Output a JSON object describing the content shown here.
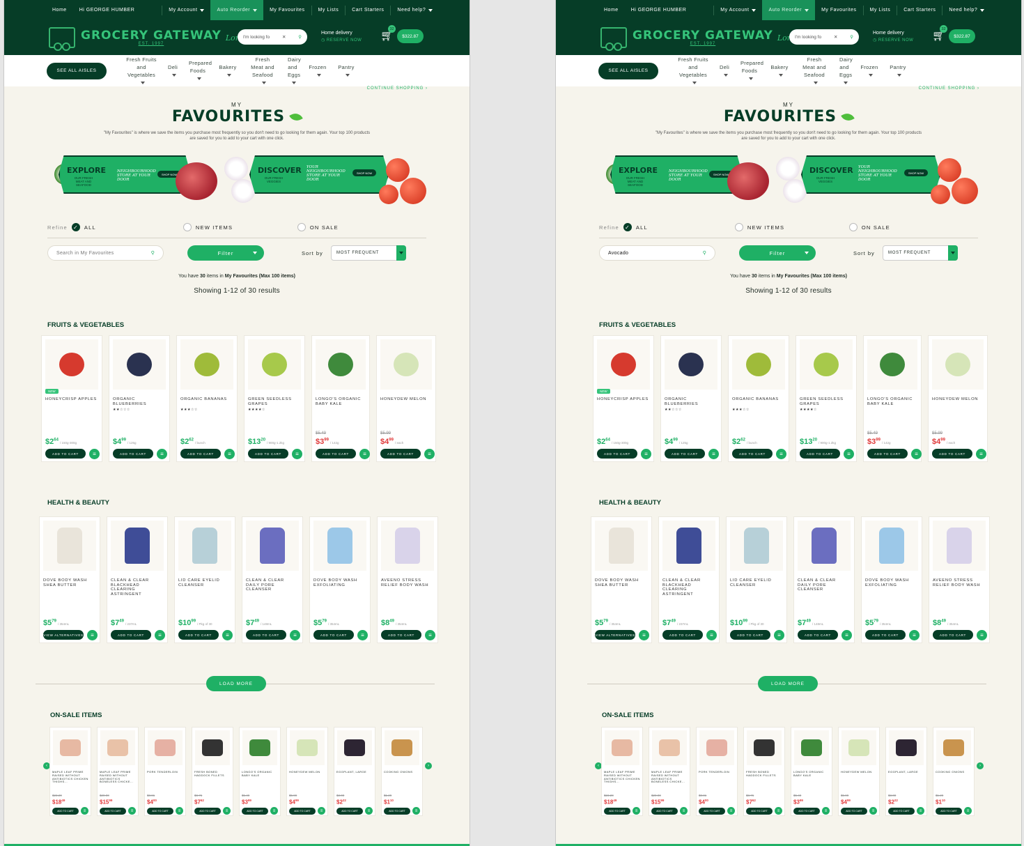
{
  "topbar": {
    "home": "Home",
    "greeting": "Hi  GEORGE HUMBER",
    "my_account": "My Account",
    "auto_reorder": "Auto Reorder",
    "my_favourites": "My Favourites",
    "my_lists": "My Lists",
    "cart_starters": "Cart Starters",
    "need_help": "Need help?"
  },
  "header": {
    "logo": "GROCERY GATEWAY",
    "logo_sub": "EST. 1997",
    "logo_script": "Longo's",
    "search_placeholder": "I'm looking fo",
    "delivery_title": "Home delivery",
    "delivery_sub": "RESERVE NOW",
    "cart_count": "32",
    "cart_total": "$322.87"
  },
  "nav": {
    "aisles_button": "SEE ALL AISLES",
    "items": [
      "Fresh Fruits and Vegetables",
      "Deli",
      "Prepared Foods",
      "Bakery",
      "Fresh Meat and Seafood",
      "Dairy and Eggs",
      "Frozen",
      "Pantry"
    ],
    "continue": "CONTINUE SHOPPING  ›"
  },
  "page": {
    "my": "MY",
    "title": "FAVOURITES",
    "desc": "\"My Favourites\" is where we save the items you purchase most frequently so you don't need to go looking for them again. Your top 100 products are saved for you to add to your cart with one click."
  },
  "banners": [
    {
      "big": "EXPLORE",
      "small": "OUR FRESH MEAT AND SEAFOOD",
      "script": "NEIGHBOURHOOD STORE AT YOUR DOOR",
      "shop": "SHOP NOW"
    },
    {
      "big": "DISCOVER",
      "small": "OUR FRESH VEGGIES",
      "script": "YOUR NEIGHBOURHOOD STORE AT YOUR DOOR",
      "shop": "SHOP NOW"
    }
  ],
  "refine": {
    "label": "Refine",
    "all": "ALL",
    "new_items": "NEW ITEMS",
    "on_sale": "ON SALE"
  },
  "controls": {
    "search_placeholder_left": "Search in My Favourites",
    "search_value_right": "Avocado",
    "filter": "Filter",
    "sort_label": "Sort by",
    "sort_value": "MOST FREQUENT"
  },
  "summary": {
    "prefix": "You have",
    "count": "30",
    "mid": "items in",
    "list": "My Favourites (Max 100 items)",
    "showing": "Showing 1-12 of 30 results"
  },
  "sections": {
    "fruits": "FRUITS & VEGETABLES",
    "health": "HEALTH & BEAUTY",
    "onsale": "ON-SALE ITEMS",
    "load_more": "LOAD MORE"
  },
  "fruits": [
    {
      "name": "HONEYCRISP APPLES",
      "stars": "",
      "was": "",
      "price": "$2",
      "cents": "64",
      "unit": "/ 150g-300g",
      "sale": false,
      "tag": "NEW",
      "btn": "ADD TO CART",
      "color": "#d63a2e"
    },
    {
      "name": "ORGANIC BLUEBERRIES",
      "stars": "★★☆☆☆",
      "was": "",
      "price": "$4",
      "cents": "99",
      "unit": "/ 125g",
      "sale": false,
      "tag": "",
      "btn": "ADD TO CART",
      "color": "#2a3250"
    },
    {
      "name": "ORGANIC BANANAS",
      "stars": "★★★☆☆",
      "was": "",
      "price": "$2",
      "cents": "62",
      "unit": "/ bunch",
      "sale": false,
      "tag": "",
      "btn": "ADD TO CART",
      "color": "#9fbb3a"
    },
    {
      "name": "GREEN SEEDLESS GRAPES",
      "stars": "★★★★☆",
      "was": "",
      "price": "$13",
      "cents": "20",
      "unit": "/ 900g-1.2kg",
      "sale": false,
      "tag": "",
      "btn": "ADD TO CART",
      "color": "#a7c94b"
    },
    {
      "name": "LONGO'S ORGANIC BABY KALE",
      "stars": "",
      "was": "$5.49",
      "price": "$3",
      "cents": "99",
      "unit": "/ 142g",
      "sale": true,
      "tag": "",
      "btn": "ADD TO CART",
      "color": "#3f8a3c"
    },
    {
      "name": "HONEYDEW MELON",
      "stars": "",
      "was": "$5.99",
      "price": "$4",
      "cents": "99",
      "unit": "/ each",
      "sale": true,
      "tag": "",
      "btn": "ADD TO CART",
      "color": "#d6e5b8"
    }
  ],
  "health": [
    {
      "name": "DOVE BODY WASH SHEA BUTTER",
      "stars": "",
      "was": "",
      "price": "$5",
      "cents": "79",
      "unit": "/ 354mL",
      "sale": false,
      "tag": "",
      "btn": "VIEW ALTERNATIVES",
      "color": "#e9e4da"
    },
    {
      "name": "CLEAN & CLEAR BLACKHEAD CLEARING ASTRINGENT",
      "stars": "",
      "was": "",
      "price": "$7",
      "cents": "49",
      "unit": "/ 237mL",
      "sale": false,
      "tag": "",
      "btn": "ADD TO CART",
      "color": "#3f4d97"
    },
    {
      "name": "LID CARE EYELID CLEANSER",
      "stars": "",
      "was": "",
      "price": "$10",
      "cents": "99",
      "unit": "/ Pkg of 30",
      "sale": false,
      "tag": "",
      "btn": "ADD TO CART",
      "color": "#b7d0d8"
    },
    {
      "name": "CLEAN & CLEAR DAILY PORE CLEANSER",
      "stars": "",
      "was": "",
      "price": "$7",
      "cents": "49",
      "unit": "/ 148mL",
      "sale": false,
      "tag": "",
      "btn": "ADD TO CART",
      "color": "#6b6ec0"
    },
    {
      "name": "DOVE BODY WASH EXFOLIATING",
      "stars": "",
      "was": "",
      "price": "$5",
      "cents": "79",
      "unit": "/ 354mL",
      "sale": false,
      "tag": "",
      "btn": "ADD TO CART",
      "color": "#9cc8e8"
    },
    {
      "name": "AVEENO STRESS RELIEF BODY WASH",
      "stars": "",
      "was": "",
      "price": "$8",
      "cents": "49",
      "unit": "/ 354mL",
      "sale": false,
      "tag": "",
      "btn": "ADD TO CART",
      "color": "#d9d3ea"
    }
  ],
  "onsale": [
    {
      "name": "MAPLE LEAF PRIME RAISED WITHOUT ANTIBIOTICS CHICKEN THIGHS...",
      "was": "$23.20",
      "price": "$18",
      "cents": "49",
      "btn": "ADD TO CART",
      "color": "#e7b9a3"
    },
    {
      "name": "MAPLE LEAF PRIME RAISED WITHOUT ANTIBIOTICS BONELESS CHICKE...",
      "was": "$20.00",
      "price": "$15",
      "cents": "99",
      "btn": "ADD TO CART",
      "color": "#e9c2a8"
    },
    {
      "name": "PORK TENDERLOIN",
      "was": "$8.81",
      "price": "$4",
      "cents": "00",
      "btn": "ADD TO CART",
      "color": "#e6b1a4"
    },
    {
      "name": "FRESH BONED HADDOCK FILLETS",
      "was": "$8.76",
      "price": "$7",
      "cents": "62",
      "btn": "ADD TO CART",
      "color": "#333333"
    },
    {
      "name": "LONGO'S ORGANIC BABY KALE",
      "was": "$5.49",
      "price": "$3",
      "cents": "99",
      "btn": "ADD TO CART",
      "color": "#3f8a3c"
    },
    {
      "name": "HONEYDEW MELON",
      "was": "$5.99",
      "price": "$4",
      "cents": "99",
      "btn": "ADD TO CART",
      "color": "#d6e5b8"
    },
    {
      "name": "EGGPLANT, LARGE",
      "was": "$3.00",
      "price": "$2",
      "cents": "22",
      "btn": "ADD TO CART",
      "color": "#2d2533"
    },
    {
      "name": "COOKING ONIONS",
      "was": "$1.29",
      "price": "$1",
      "cents": "10",
      "btn": "ADD TO CART",
      "color": "#c9944e"
    }
  ],
  "colors": {
    "dark_green": "#063d27",
    "accent_green": "#1fb065",
    "sale_red": "#e03a3a",
    "page_bg": "#f6f4ec"
  }
}
